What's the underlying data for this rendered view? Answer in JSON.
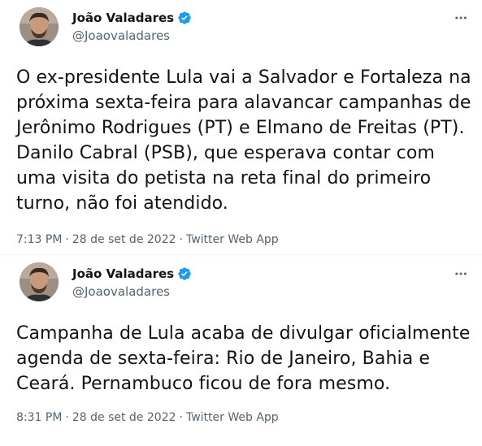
{
  "tweets": [
    {
      "author": "João Valadares",
      "handle": "@Joaovaladares",
      "text": "O ex-presidente Lula vai a Salvador e Fortaleza na\npróxima sexta-feira para alavancar campanhas de\nJerônimo Rodrigues (PT) e Elmano de Freitas (PT).\nDanilo Cabral (PSB), que esperava contar com\numa visita do petista na reta final do primeiro\nturno, não foi atendido.",
      "time": "7:13 PM",
      "date": "28 de set de 2022",
      "source": "Twitter Web App",
      "separator": "·"
    },
    {
      "author": "João Valadares",
      "handle": "@Joaovaladares",
      "text": "Campanha de Lula acaba de divulgar oficialmente\nagenda de sexta-feira: Rio de Janeiro, Bahia e\nCeará. Pernambuco ficou de fora mesmo.",
      "time": "8:31 PM",
      "date": "28 de set de 2022",
      "source": "Twitter Web App",
      "separator": "·"
    }
  ],
  "icons": {
    "verified": "verified-badge-icon",
    "more": "more-options-icon"
  },
  "colors": {
    "verified": "#1d9bf0",
    "secondary_text": "#536471",
    "primary_text": "#0f1419"
  }
}
